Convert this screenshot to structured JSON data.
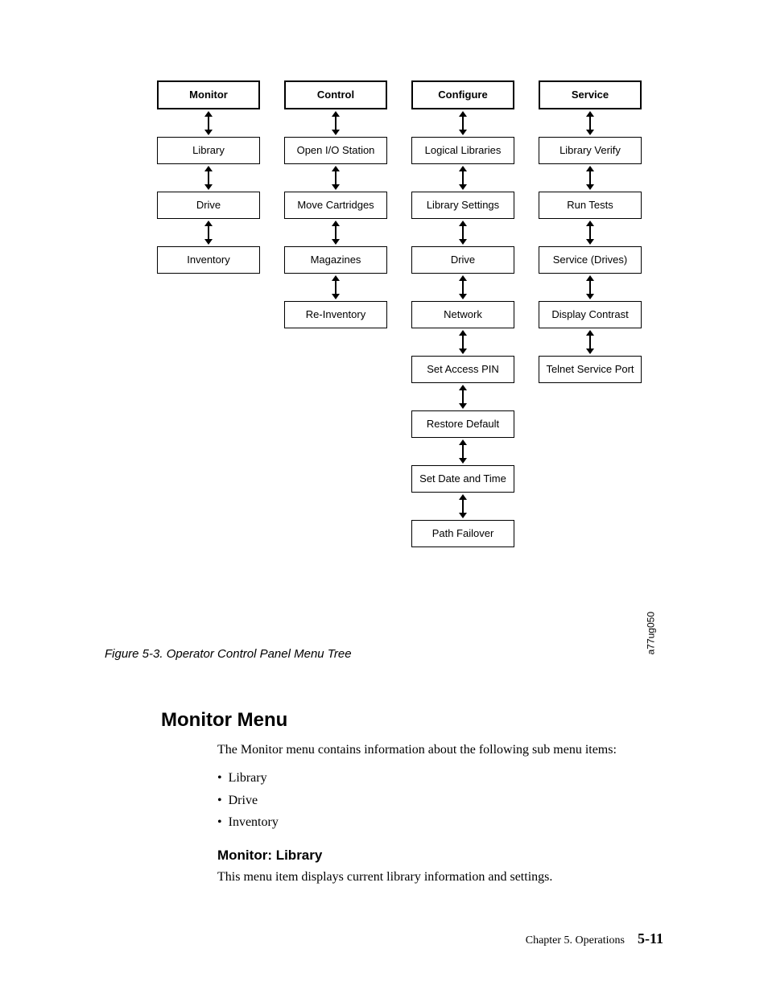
{
  "chart_data": {
    "type": "tree",
    "columns": [
      {
        "header": "Monitor",
        "items": [
          "Library",
          "Drive",
          "Inventory"
        ]
      },
      {
        "header": "Control",
        "items": [
          "Open I/O Station",
          "Move Cartridges",
          "Magazines",
          "Re-Inventory"
        ]
      },
      {
        "header": "Configure",
        "items": [
          "Logical Libraries",
          "Library Settings",
          "Drive",
          "Network",
          "Set Access PIN",
          "Restore Default",
          "Set Date and Time",
          "Path Failover"
        ]
      },
      {
        "header": "Service",
        "items": [
          "Library Verify",
          "Run Tests",
          "Service (Drives)",
          "Display Contrast",
          "Telnet Service Port"
        ]
      }
    ]
  },
  "diagram": {
    "headers": [
      "Monitor",
      "Control",
      "Configure",
      "Service"
    ],
    "cols": [
      [
        "Library",
        "Drive",
        "Inventory"
      ],
      [
        "Open I/O Station",
        "Move Cartridges",
        "Magazines",
        "Re-Inventory"
      ],
      [
        "Logical Libraries",
        "Library Settings",
        "Drive",
        "Network",
        "Set Access PIN",
        "Restore Default",
        "Set Date and Time",
        "Path Failover"
      ],
      [
        "Library Verify",
        "Run Tests",
        "Service (Drives)",
        "Display Contrast",
        "Telnet Service Port"
      ]
    ],
    "figref": "a77ug050"
  },
  "figcaption": "Figure 5-3. Operator Control Panel Menu Tree",
  "h2": "Monitor Menu",
  "intro": "The Monitor menu contains information about the following sub menu items:",
  "bullets": [
    "Library",
    "Drive",
    "Inventory"
  ],
  "h3": "Monitor: Library",
  "subtext": "This menu item displays current library information and settings.",
  "footer_chapter": "Chapter 5. Operations",
  "footer_page": "5-11"
}
